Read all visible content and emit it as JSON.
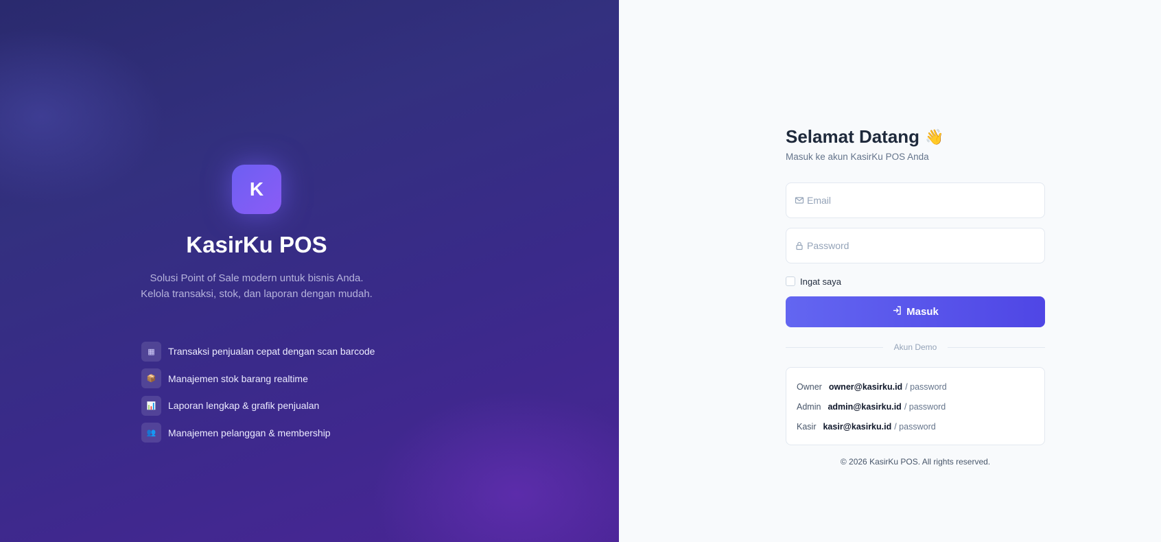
{
  "brand": {
    "logo_letter": "K",
    "title": "KasirKu POS",
    "description": "Solusi Point of Sale modern untuk bisnis Anda. Kelola transaksi, stok, dan laporan dengan mudah."
  },
  "features": [
    {
      "icon": "barcode-icon",
      "glyph": "▦",
      "text": "Transaksi penjualan cepat dengan scan barcode"
    },
    {
      "icon": "box-icon",
      "glyph": "📦",
      "text": "Manajemen stok barang realtime"
    },
    {
      "icon": "chart-icon",
      "glyph": "📊",
      "text": "Laporan lengkap & grafik penjualan"
    },
    {
      "icon": "people-icon",
      "glyph": "👥",
      "text": "Manajemen pelanggan & membership"
    }
  ],
  "login": {
    "title": "Selamat Datang",
    "wave": "👋",
    "subtitle": "Masuk ke akun KasirKu POS Anda",
    "email_placeholder": "Email",
    "password_placeholder": "Password",
    "remember_label": "Ingat saya",
    "submit_label": "Masuk",
    "demo_divider": "Akun Demo"
  },
  "demo_accounts": [
    {
      "role": "Owner",
      "email": "owner@kasirku.id",
      "password": "/ password"
    },
    {
      "role": "Admin",
      "email": "admin@kasirku.id",
      "password": "/ password"
    },
    {
      "role": "Kasir",
      "email": "kasir@kasirku.id",
      "password": "/ password"
    }
  ],
  "footer": "© 2026 KasirKu POS. All rights reserved.",
  "colors": {
    "accent": "#4f46e5",
    "left_bg": "#33307f"
  }
}
